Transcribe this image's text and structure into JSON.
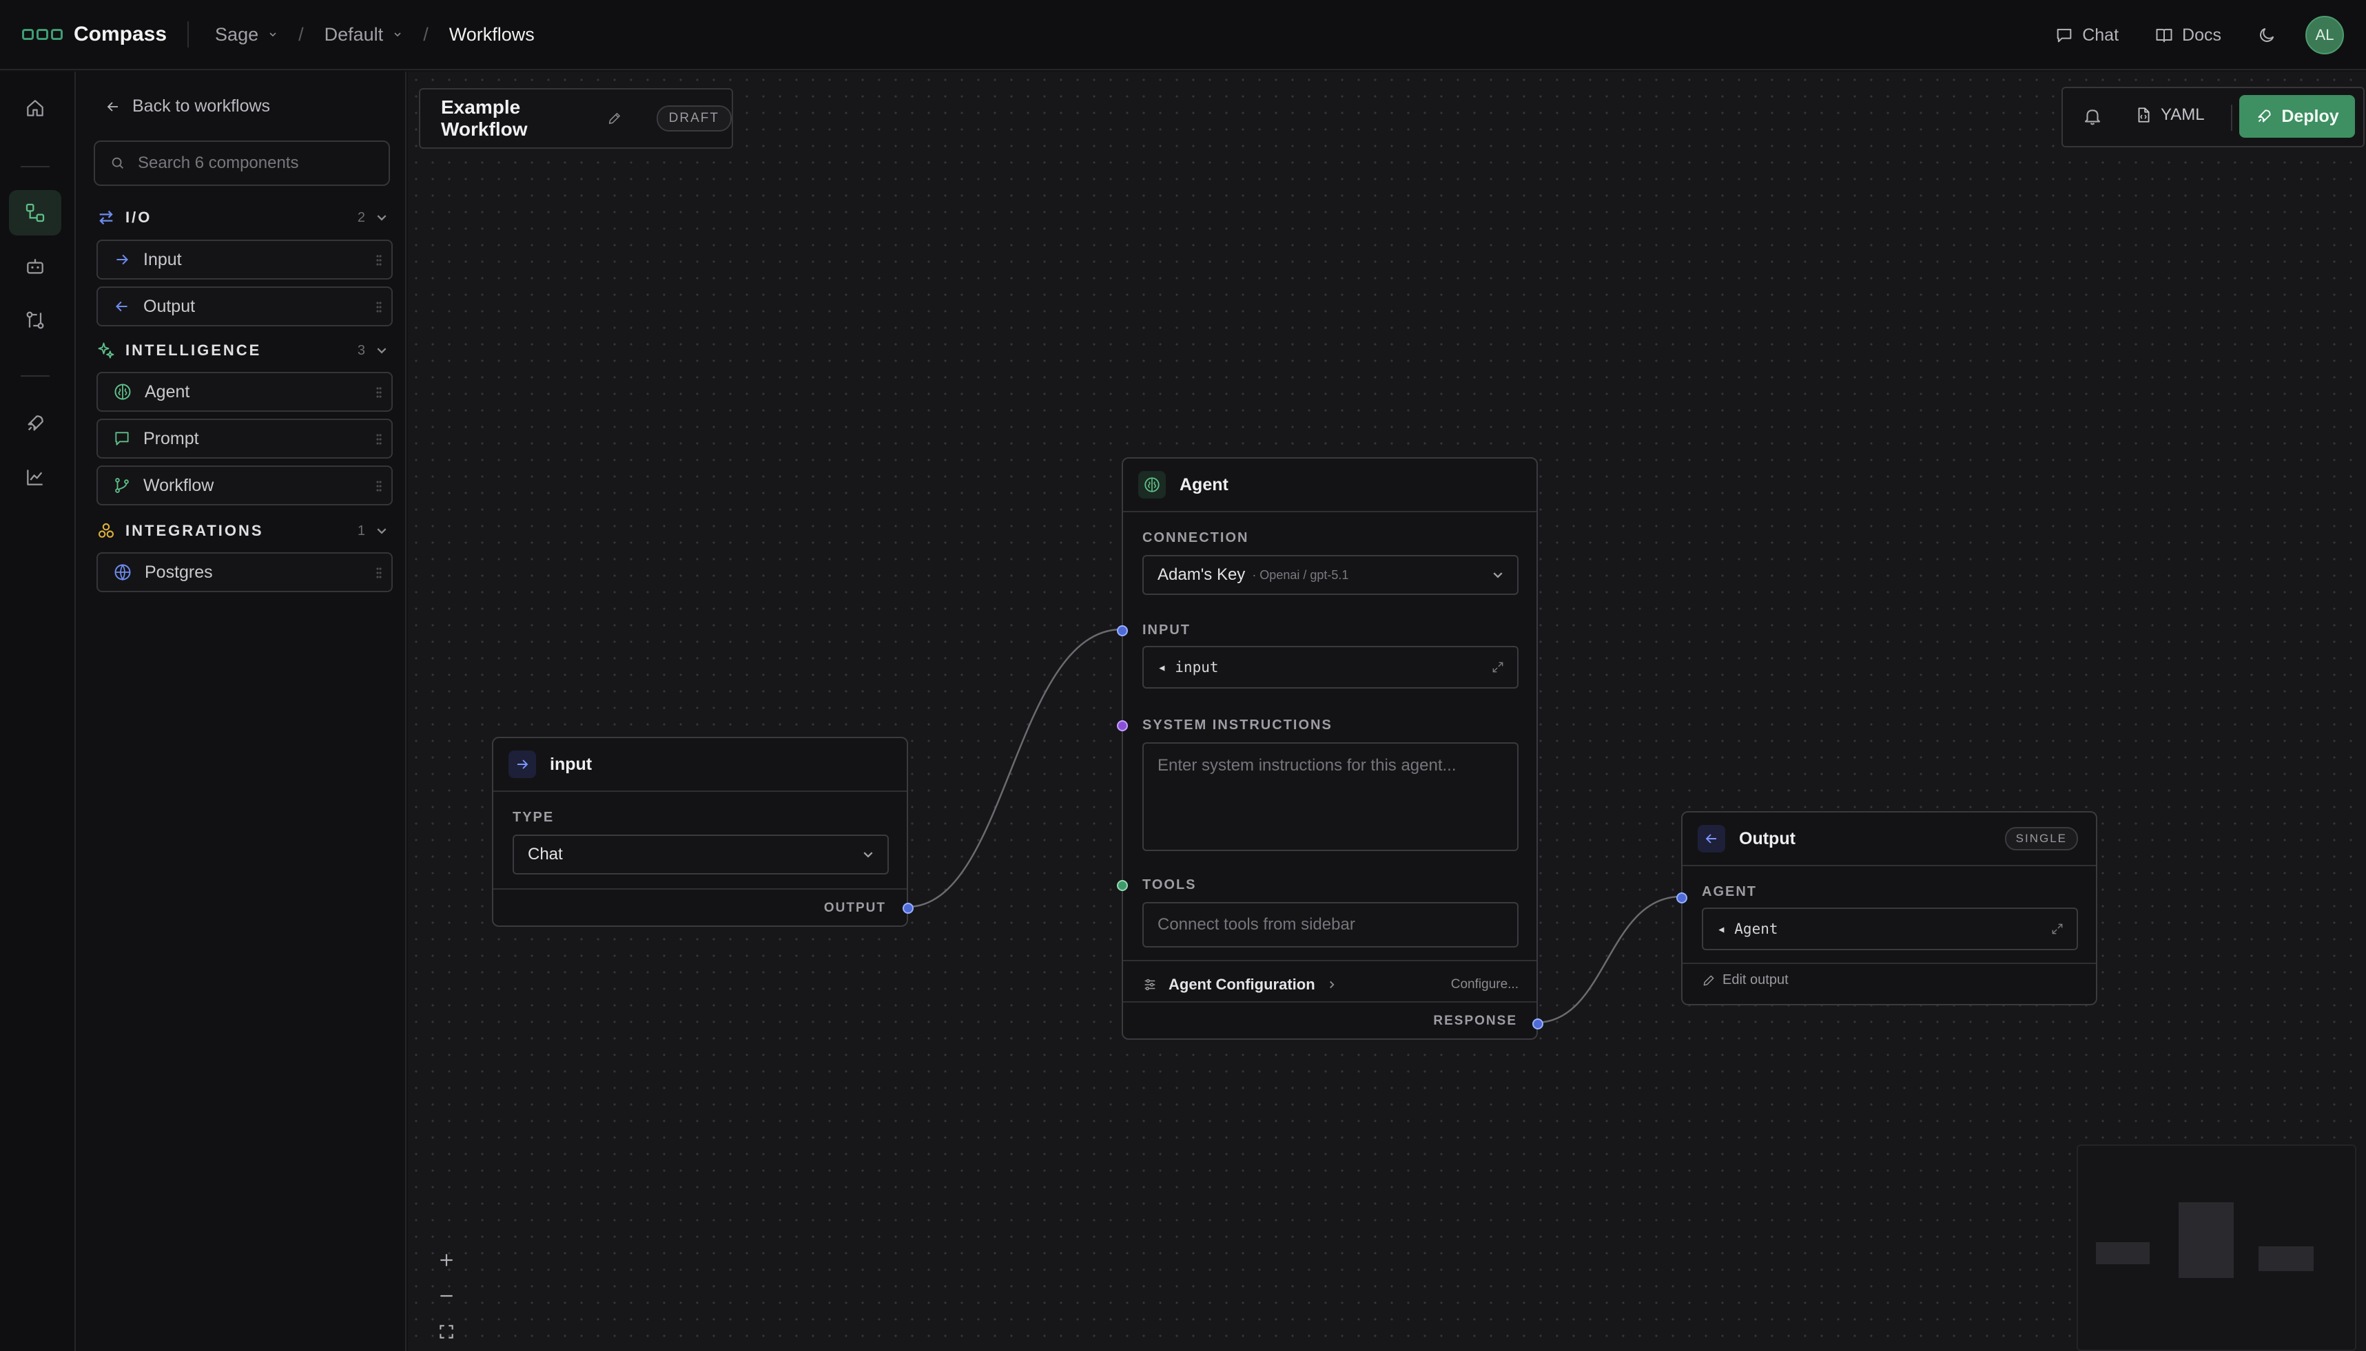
{
  "topbar": {
    "app_name": "Compass",
    "breadcrumbs": [
      "Sage",
      "Default"
    ],
    "current": "Workflows",
    "chat_label": "Chat",
    "docs_label": "Docs",
    "avatar_initials": "AL"
  },
  "sidebar": {
    "back_label": "Back to workflows",
    "search_placeholder": "Search 6 components",
    "categories": [
      {
        "label": "I/O",
        "count": "2",
        "items": [
          "Input",
          "Output"
        ]
      },
      {
        "label": "INTELLIGENCE",
        "count": "3",
        "items": [
          "Agent",
          "Prompt",
          "Workflow"
        ]
      },
      {
        "label": "INTEGRATIONS",
        "count": "1",
        "items": [
          "Postgres"
        ]
      }
    ]
  },
  "workflow": {
    "title": "Example Workflow",
    "status": "DRAFT",
    "yaml_label": "YAML",
    "deploy_label": "Deploy"
  },
  "nodes": {
    "input": {
      "title": "input",
      "type_label": "TYPE",
      "type_value": "Chat",
      "output_label": "OUTPUT"
    },
    "agent": {
      "title": "Agent",
      "connection_label": "CONNECTION",
      "connection_name": "Adam's Key",
      "connection_detail": "· Openai / gpt-5.1",
      "input_label": "INPUT",
      "input_value": "◂ input",
      "system_label": "SYSTEM INSTRUCTIONS",
      "system_placeholder": "Enter system instructions for this agent...",
      "tools_label": "TOOLS",
      "tools_placeholder": "Connect tools from sidebar",
      "config_label": "Agent Configuration",
      "config_action": "Configure...",
      "response_label": "RESPONSE"
    },
    "output": {
      "title": "Output",
      "badge": "SINGLE",
      "agent_label": "AGENT",
      "agent_value": "◂ Agent",
      "edit_label": "Edit output"
    }
  },
  "colors": {
    "accent": "#3e8f62",
    "port_blue": "#4f6bd8",
    "port_purple": "#8a4fd8",
    "port_green": "#3e9a6a"
  }
}
